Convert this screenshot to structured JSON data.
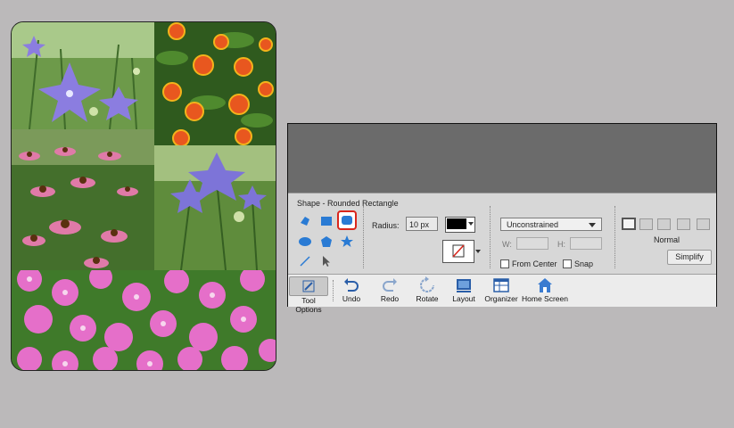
{
  "collage": {
    "photos": [
      {
        "subject": "balloon-flowers-purple"
      },
      {
        "subject": "zinnias-orange"
      },
      {
        "subject": "coneflowers-pink"
      },
      {
        "subject": "balloon-flower-purple-closeup"
      },
      {
        "subject": "petunias-pink"
      }
    ]
  },
  "options": {
    "shape_title": "Shape - Rounded Rectangle",
    "radius_label": "Radius:",
    "radius_value": "10 px",
    "constraint_value": "Unconstrained",
    "w_label": "W:",
    "h_label": "H:",
    "from_center_label": "From Center",
    "snap_label": "Snap",
    "mode_label": "Normal",
    "simplify_label": "Simplify",
    "fill_color": "#000000",
    "tools": [
      "custom-shape",
      "rectangle",
      "rounded-rectangle",
      "ellipse",
      "polygon",
      "star",
      "line",
      "selection"
    ]
  },
  "toolbar": {
    "items": [
      {
        "label": "Tool Options",
        "icon": "pencil-icon"
      },
      {
        "label": "Undo",
        "icon": "undo-icon"
      },
      {
        "label": "Redo",
        "icon": "redo-icon"
      },
      {
        "label": "Rotate",
        "icon": "rotate-icon"
      },
      {
        "label": "Layout",
        "icon": "layout-icon"
      },
      {
        "label": "Organizer",
        "icon": "organizer-icon"
      },
      {
        "label": "Home Screen",
        "icon": "home-icon"
      }
    ]
  },
  "colors": {
    "accent_selected_outline": "#d9261c",
    "tool_blue": "#2a7bd4"
  }
}
